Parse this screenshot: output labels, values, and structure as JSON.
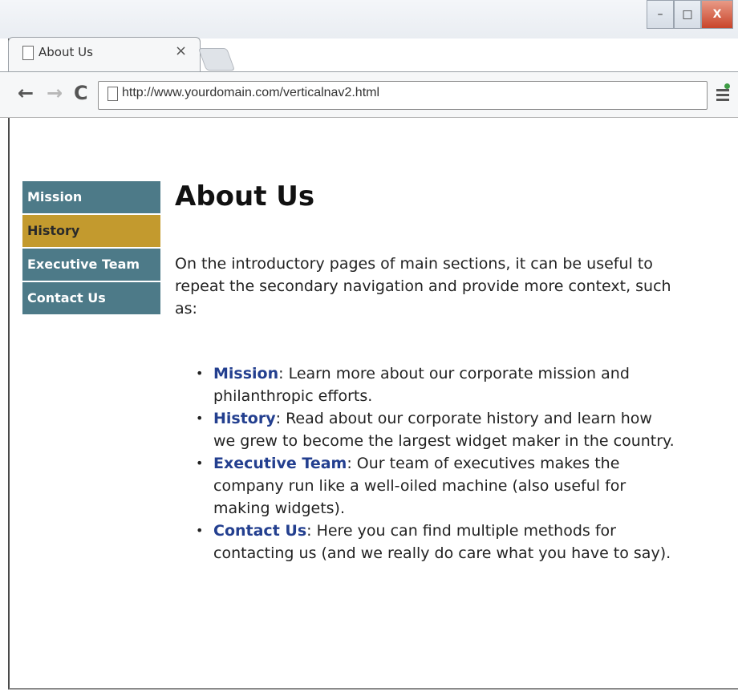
{
  "browser": {
    "tab_title": "About Us",
    "tab_close": "×",
    "url": "http://www.yourdomain.com/verticalnav2.html",
    "controls": {
      "minimize": "–",
      "maximize": "□",
      "close": "X"
    },
    "nav": {
      "back": "←",
      "forward": "→",
      "reload": "C"
    }
  },
  "sidenav": {
    "items": [
      {
        "label": "Mission",
        "active": false
      },
      {
        "label": "History",
        "active": true
      },
      {
        "label": "Executive Team",
        "active": false
      },
      {
        "label": "Contact Us",
        "active": false
      }
    ]
  },
  "content": {
    "heading": "About Us",
    "intro": "On the introductory pages of main sections, it can be useful to repeat the secondary navigation and provide more context, such as:",
    "list": [
      {
        "term": "Mission",
        "text": ": Learn more about our corporate mission and philanthropic efforts."
      },
      {
        "term": "History",
        "text": ": Read about our corporate history and learn how we grew to become the largest widget maker in the country."
      },
      {
        "term": "Executive Team",
        "text": ": Our team of executives makes the company run like a well-oiled machine (also useful for making widgets)."
      },
      {
        "term": "Contact Us",
        "text": ": Here you can find multiple methods for contacting us (and we really do care what you have to say)."
      }
    ]
  },
  "colors": {
    "nav_bg": "#4d7a88",
    "nav_active_bg": "#c39a2e",
    "link_term": "#233f8f"
  }
}
